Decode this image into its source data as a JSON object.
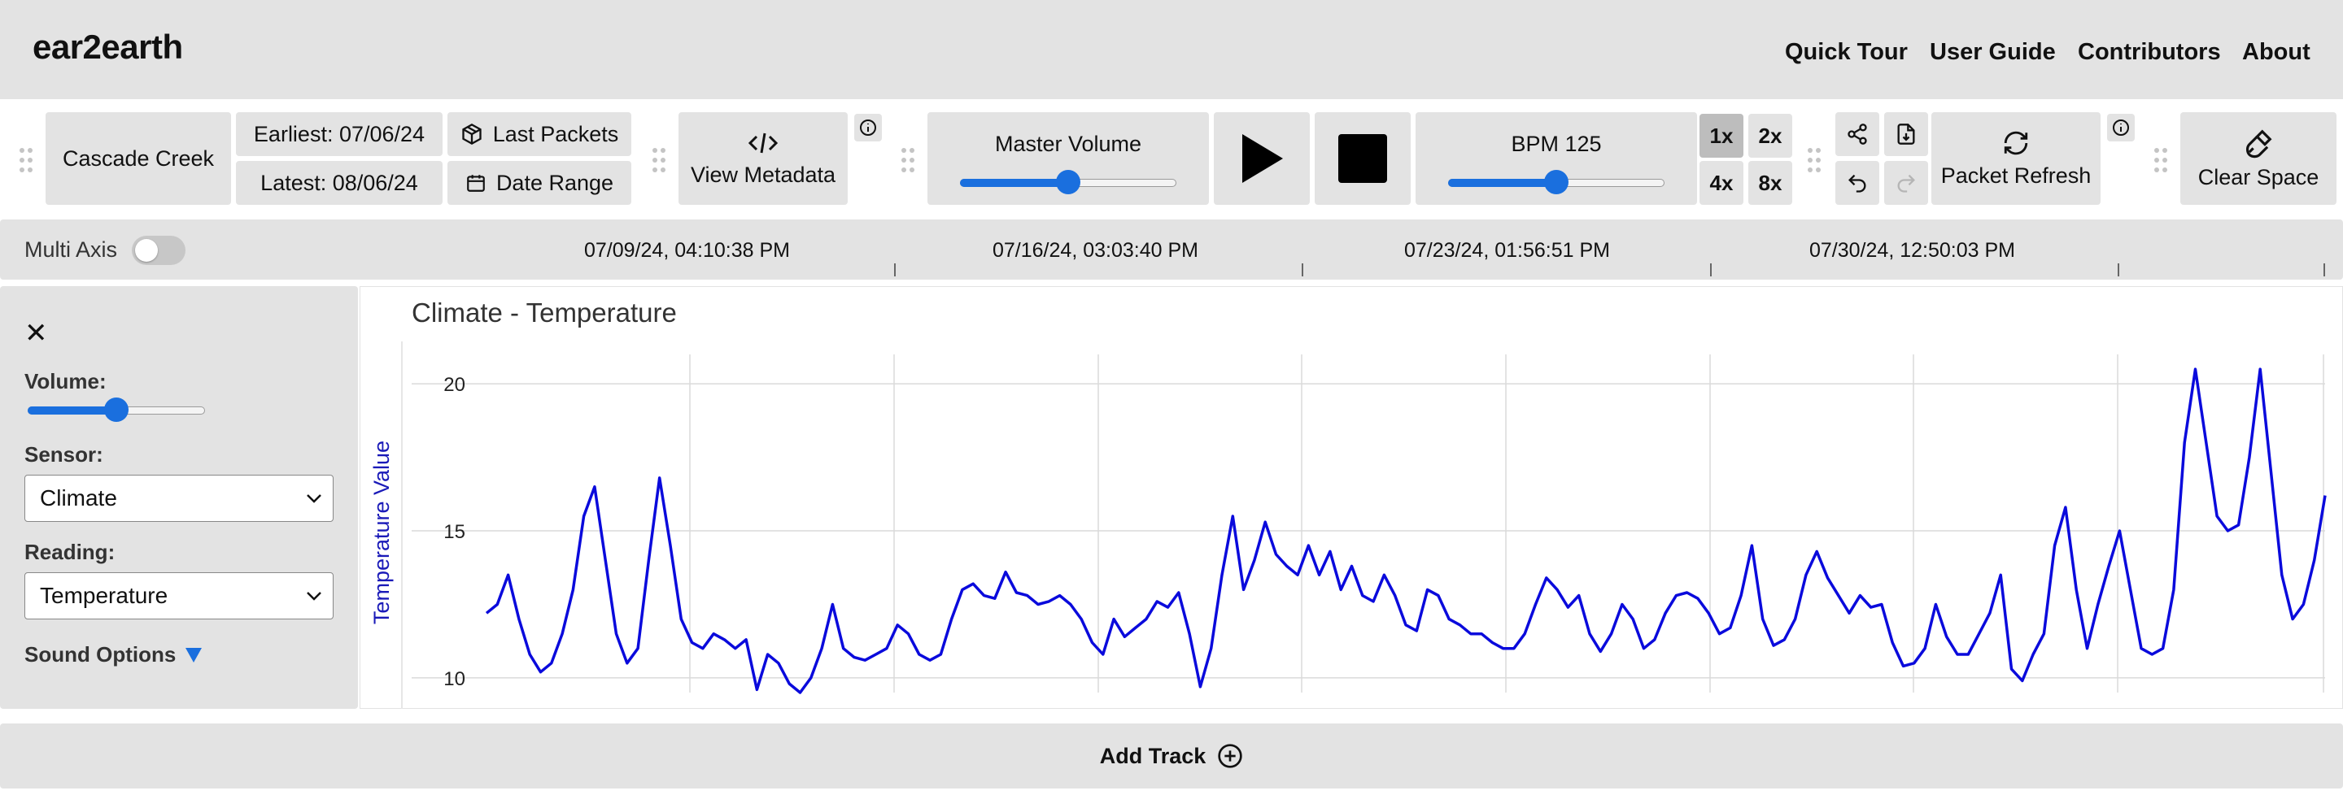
{
  "app": {
    "title": "ear2earth"
  },
  "nav": [
    {
      "label": "Quick Tour"
    },
    {
      "label": "User Guide"
    },
    {
      "label": "Contributors"
    },
    {
      "label": "About"
    }
  ],
  "toolbar": {
    "site": "Cascade Creek",
    "earliest": "Earliest: 07/06/24",
    "latest": "Latest: 08/06/24",
    "last_packets": "Last Packets",
    "date_range": "Date Range",
    "view_metadata": "View Metadata",
    "master_volume_label": "Master Volume",
    "master_volume_value": 0.5,
    "bpm_label": "BPM 125",
    "bpm_slider_value": 0.5,
    "speeds": [
      "1x",
      "2x",
      "4x",
      "8x"
    ],
    "active_speed": "1x",
    "packet_refresh": "Packet Refresh",
    "clear_space": "Clear Space"
  },
  "timeline": {
    "multi_axis_label": "Multi Axis",
    "multi_axis_on": false,
    "ticks": [
      "07/09/24, 04:10:38 PM",
      "07/16/24, 03:03:40 PM",
      "07/23/24, 01:56:51 PM",
      "07/30/24, 12:50:03 PM"
    ]
  },
  "track": {
    "volume_label": "Volume:",
    "volume_value": 0.5,
    "sensor_label": "Sensor:",
    "sensor_value": "Climate",
    "reading_label": "Reading:",
    "reading_value": "Temperature",
    "sound_options": "Sound Options",
    "close_symbol": "✕"
  },
  "add_track": {
    "label": "Add Track"
  },
  "colors": {
    "accent": "#1a6fde",
    "line": "#0a0adc",
    "panel": "#e3e3e3"
  },
  "chart_data": {
    "type": "line",
    "title": "Climate - Temperature",
    "ylabel": "Temperature Value",
    "xlabel": "",
    "ylim": [
      9.5,
      21
    ],
    "yticks": [
      10,
      15,
      20
    ],
    "grid": true,
    "series": [
      {
        "values": [
          12.2,
          12.5,
          13.5,
          12.0,
          10.8,
          10.2,
          10.5,
          11.5,
          13.0,
          15.5,
          16.5,
          14.0,
          11.5,
          10.5,
          11.0,
          14.0,
          16.8,
          14.5,
          12.0,
          11.2,
          11.0,
          11.5,
          11.3,
          11.0,
          11.3,
          9.6,
          10.8,
          10.5,
          9.8,
          9.5,
          10.0,
          11.0,
          12.5,
          11.0,
          10.7,
          10.6,
          10.8,
          11.0,
          11.8,
          11.5,
          10.8,
          10.6,
          10.8,
          12.0,
          13.0,
          13.2,
          12.8,
          12.7,
          13.6,
          12.9,
          12.8,
          12.5,
          12.6,
          12.8,
          12.5,
          12.0,
          11.2,
          10.8,
          12.0,
          11.4,
          11.7,
          12.0,
          12.6,
          12.4,
          12.9,
          11.5,
          9.7,
          11.0,
          13.5,
          15.5,
          13.0,
          14.0,
          15.3,
          14.2,
          13.8,
          13.5,
          14.5,
          13.5,
          14.3,
          13.0,
          13.8,
          12.8,
          12.6,
          13.5,
          12.8,
          11.8,
          11.6,
          13.0,
          12.8,
          12.0,
          11.8,
          11.5,
          11.5,
          11.2,
          11.0,
          11.0,
          11.5,
          12.5,
          13.4,
          13.0,
          12.4,
          12.8,
          11.5,
          10.9,
          11.5,
          12.5,
          12.0,
          11.0,
          11.3,
          12.2,
          12.8,
          12.9,
          12.7,
          12.2,
          11.5,
          11.7,
          12.8,
          14.5,
          12.0,
          11.1,
          11.3,
          12.0,
          13.5,
          14.3,
          13.4,
          12.8,
          12.2,
          12.8,
          12.4,
          12.5,
          11.2,
          10.4,
          10.5,
          11.0,
          12.5,
          11.4,
          10.8,
          10.8,
          11.5,
          12.2,
          13.5,
          10.3,
          9.9,
          10.8,
          11.5,
          14.5,
          15.8,
          13.0,
          11.0,
          12.5,
          13.8,
          15.0,
          13.0,
          11.0,
          10.8,
          11.0,
          13.0,
          18.0,
          20.5,
          18.0,
          15.5,
          15.0,
          15.2,
          17.5,
          20.5,
          17.0,
          13.5,
          12.0,
          12.5,
          14.0,
          16.2
        ]
      }
    ]
  }
}
